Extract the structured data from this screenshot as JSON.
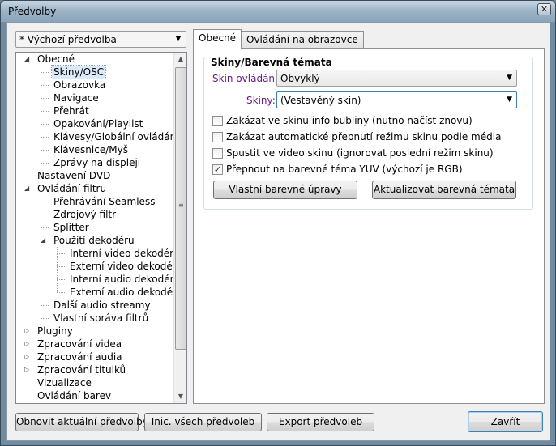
{
  "window": {
    "title": "Předvolby",
    "close_glyph": "✕"
  },
  "preset": {
    "selected": "* Výchozí předvolba"
  },
  "tree": {
    "items": [
      {
        "label": "Obecné",
        "expanded": true
      },
      {
        "label": "Skiny/OSC",
        "selected": true
      },
      {
        "label": "Obrazovka"
      },
      {
        "label": "Navigace"
      },
      {
        "label": "Přehrát"
      },
      {
        "label": "Opakování/Playlist"
      },
      {
        "label": "Klávesy/Globální ovládání"
      },
      {
        "label": "Klávesnice/Myš"
      },
      {
        "label": "Zprávy na displeji"
      },
      {
        "label": "Nastavení DVD"
      },
      {
        "label": "Ovládání filtru",
        "expanded": true
      },
      {
        "label": "Přehrávání Seamless"
      },
      {
        "label": "Zdrojový filtr"
      },
      {
        "label": "Splitter"
      },
      {
        "label": "Použití dekodéru",
        "expanded": true
      },
      {
        "label": "Interní video dekodér"
      },
      {
        "label": "Externí video dekodér"
      },
      {
        "label": "Interní audio dekodér"
      },
      {
        "label": "Externí audio dekodér"
      },
      {
        "label": "Další audio streamy"
      },
      {
        "label": "Vlastní správa filtrů"
      },
      {
        "label": "Pluginy",
        "expanded": false
      },
      {
        "label": "Zpracování videa",
        "expanded": false
      },
      {
        "label": "Zpracování audia",
        "expanded": false
      },
      {
        "label": "Zpracování titulků",
        "expanded": false
      },
      {
        "label": "Vizualizace"
      },
      {
        "label": "Ovládání barev"
      }
    ]
  },
  "tabs": [
    {
      "label": "Obecné",
      "active": true
    },
    {
      "label": "Ovládání na obrazovce",
      "active": false
    }
  ],
  "skins_group": {
    "title": "Skiny/Barevná témata",
    "skin_control_label": "Skin ovládání:",
    "skin_control_value": "Obvyklý",
    "skins_label": "Skiny:",
    "skins_value": "(Vestavěný skin)",
    "checkboxes": [
      {
        "label": "Zakázat ve skinu info bubliny (nutno načíst znovu)",
        "checked": false
      },
      {
        "label": "Zakázat automatické přepnutí režimu skinu podle média",
        "checked": false
      },
      {
        "label": "Spustit ve video skinu (ignorovat poslední režim skinu)",
        "checked": false
      },
      {
        "label": "Přepnout na barevné téma YUV (výchozí je RGB)",
        "checked": true
      }
    ],
    "custom_colors_button": "Vlastní barevné úpravy",
    "update_themes_button": "Aktualizovat barevná témata"
  },
  "footer": {
    "restore_button": "Obnovit aktuální předvolby",
    "init_button": "Inic. všech předvoleb",
    "export_button": "Export předvoleb",
    "close_button": "Zavřít"
  },
  "glyphs": {
    "check": "✓",
    "expanded": "◢",
    "collapsed": "▷",
    "dropdown": "▼",
    "scroll_up": "▲",
    "scroll_down": "▼",
    "grip": "≡"
  }
}
